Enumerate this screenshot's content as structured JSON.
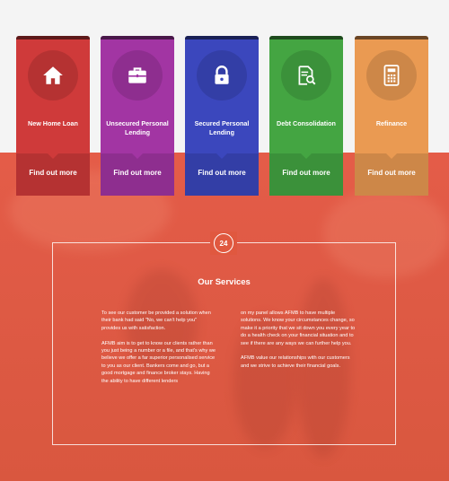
{
  "cards": [
    {
      "title": "New Home Loan",
      "cta": "Find out more",
      "icon": "home-icon",
      "color": "#cf3a3a"
    },
    {
      "title": "Unsecured Personal Lending",
      "cta": "Find out more",
      "icon": "briefcase-icon",
      "color": "#a235a3"
    },
    {
      "title": "Secured  Personal Lending",
      "cta": "Find out more",
      "icon": "lock-icon",
      "color": "#3b47bd"
    },
    {
      "title": "Debt Consolidation",
      "cta": "Find out more",
      "icon": "document-search-icon",
      "color": "#44a542"
    },
    {
      "title": "Refinance",
      "cta": "Find out more",
      "icon": "calculator-icon",
      "color": "#ea9a52"
    }
  ],
  "services": {
    "badge_number": "24",
    "badge_icon": "phone-24-icon",
    "title": "Our Services",
    "left_paragraphs": [
      "To see our customer be provided a solution when their bank had said \"No, we can't help you\" provides us with satisfaction.",
      "AFMB aim is to get to know our clients rather than you just being a number or a file, and that's why we believe we offer a far superior personalised service to you as our client. Bankers come and go, but a good mortgage and finance broker stays. Having the ability to have different lenders"
    ],
    "right_paragraphs": [
      "on my panel allows AFMB to have multiple solutions. We know your circumstances change, so make it a priority that we sit down you every year to do a health check on your financial situation and to see if there are any ways we can further help you.",
      "AFMB value our relationships with our customers and we strive to achieve their financial goals."
    ]
  }
}
